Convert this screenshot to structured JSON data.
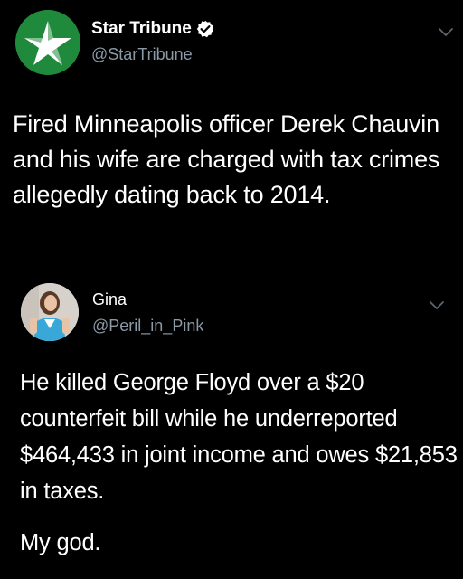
{
  "tweets": [
    {
      "author": {
        "name": "Star Tribune",
        "handle": "@StarTribune",
        "verified": true,
        "avatar_icon": "star-tribune-logo-icon"
      },
      "text": "Fired Minneapolis officer Derek Chauvin and his wife are charged with tax crimes allegedly dating back to 2014."
    },
    {
      "author": {
        "name": "Gina",
        "handle": "@Peril_in_Pink",
        "verified": false,
        "avatar_icon": "profile-photo-avatar"
      },
      "paragraphs": [
        "He killed George Floyd over a $20 counterfeit bill while he underreported $464,433 in joint income and owes $21,853 in taxes.",
        "My god."
      ]
    }
  ],
  "colors": {
    "background": "#000000",
    "text": "#ffffff",
    "secondary_text": "#8b98a5",
    "verified_badge": "#ffffff",
    "brand_green": "#1f8a3c"
  }
}
